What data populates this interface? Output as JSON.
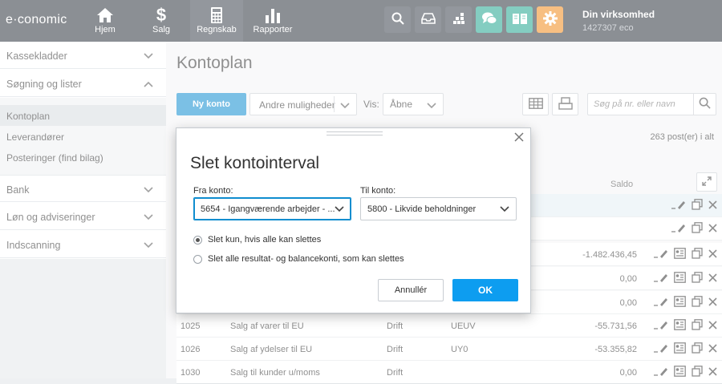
{
  "topbar": {
    "logo": "e·conomic",
    "nav": [
      {
        "label": "Hjem",
        "icon": "home-icon"
      },
      {
        "label": "Salg",
        "icon": "dollar-icon"
      },
      {
        "label": "Regnskab",
        "icon": "calculator-icon"
      },
      {
        "label": "Rapporter",
        "icon": "bar-chart-icon"
      }
    ],
    "tools": [
      {
        "icon": "search-icon",
        "color": "#3b434d"
      },
      {
        "icon": "inbox-icon",
        "color": "#3b434d"
      },
      {
        "icon": "apps-icon",
        "color": "#3b434d"
      },
      {
        "icon": "chat-icon",
        "color": "#1fa58e"
      },
      {
        "icon": "book-icon",
        "color": "#1fa58e"
      },
      {
        "icon": "gear-icon",
        "color": "#f08a1c"
      }
    ],
    "company_name": "Din virksomhed",
    "company_id": "1427307 eco"
  },
  "sidebar": {
    "sections": [
      {
        "label": "Kassekladder",
        "expanded": false
      },
      {
        "label": "Søgning og lister",
        "expanded": true
      },
      {
        "label": "Bank",
        "expanded": false
      },
      {
        "label": "Løn og adviseringer",
        "expanded": false
      },
      {
        "label": "Indscanning",
        "expanded": false
      }
    ],
    "subitems": [
      "Kontoplan",
      "Leverandører",
      "Posteringer (find bilag)"
    ],
    "active_subitem": "Kontoplan"
  },
  "main": {
    "title": "Kontoplan",
    "new_button": "Ny konto",
    "more_button": "Andre muligheder",
    "vis_label": "Vis:",
    "vis_value": "Åbne",
    "search_placeholder": "Søg på nr. eller navn",
    "post_count": "263 post(er) i alt",
    "saldo_header": "Saldo",
    "rows": [
      {
        "nr": "",
        "name": "",
        "type": "",
        "vat": "",
        "saldo": ""
      },
      {
        "nr": "",
        "name": "",
        "type": "",
        "vat": "",
        "saldo": ""
      },
      {
        "nr": "",
        "name": "",
        "type": "",
        "vat": "",
        "saldo": "-1.482.436,45"
      },
      {
        "nr": "",
        "name": "",
        "type": "",
        "vat": "",
        "saldo": "0,00"
      },
      {
        "nr": "",
        "name": "",
        "type": "",
        "vat": "",
        "saldo": "0,00"
      },
      {
        "nr": "1025",
        "name": "Salg af varer til EU",
        "type": "Drift",
        "vat": "UEUV",
        "saldo": "-55.731,56"
      },
      {
        "nr": "1026",
        "name": "Salg af ydelser til EU",
        "type": "Drift",
        "vat": "UY0",
        "saldo": "-53.355,82"
      },
      {
        "nr": "1030",
        "name": "Salg til kunder u/moms",
        "type": "Drift",
        "vat": "",
        "saldo": "0,00"
      }
    ]
  },
  "dialog": {
    "title": "Slet kontointerval",
    "from_label": "Fra konto:",
    "from_value": "5654 - Igangværende arbejder - ...",
    "to_label": "Til konto:",
    "to_value": "5800 - Likvide beholdninger",
    "radio1": "Slet kun, hvis alle kan slettes",
    "radio2": "Slet alle resultat- og balancekonti, som kan slettes",
    "radio_selected": 1,
    "cancel": "Annullér",
    "ok": "OK"
  }
}
